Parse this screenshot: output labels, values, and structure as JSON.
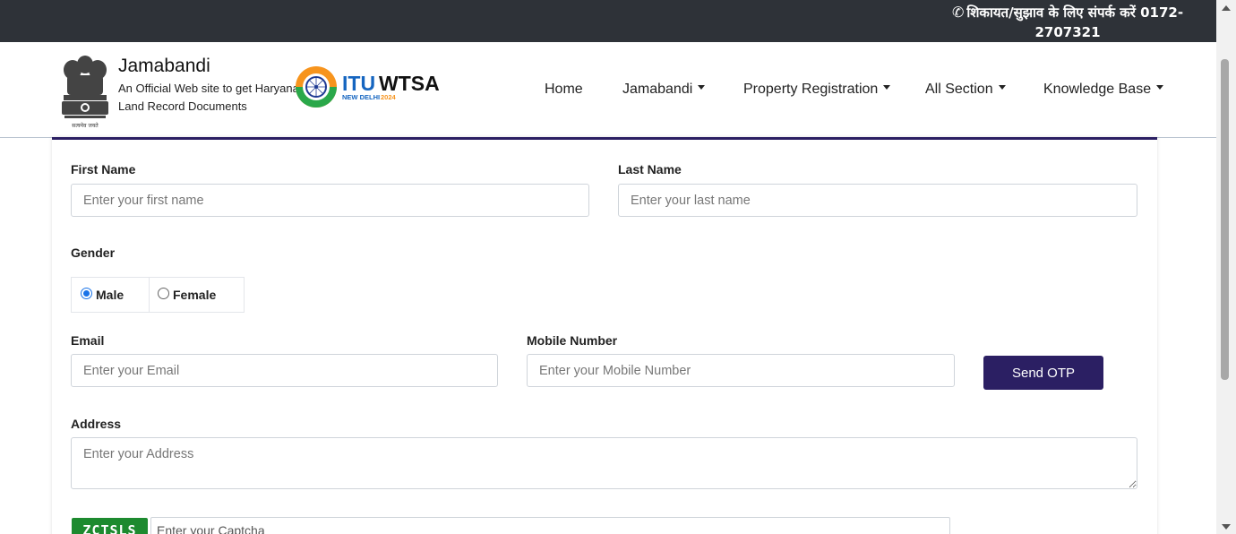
{
  "topbar": {
    "contact_text": "शिकायत/सुझाव के लिए संपर्क करें 0172-2707321",
    "phone_icon": "phone-icon"
  },
  "brand": {
    "title": "Jamabandi",
    "subtitle": "An Official Web site to get Haryana Land Record Documents",
    "emblem_caption": "सत्यमेव जयते",
    "partner_logo_text": "ITUWTSA",
    "partner_logo_subtext": "NEW DELHI 2024"
  },
  "nav": {
    "items": [
      {
        "label": "Home",
        "dropdown": false
      },
      {
        "label": "Jamabandi",
        "dropdown": true
      },
      {
        "label": "Property Registration",
        "dropdown": true
      },
      {
        "label": "All Section",
        "dropdown": true
      },
      {
        "label": "Knowledge Base",
        "dropdown": true
      }
    ]
  },
  "form": {
    "first_name": {
      "label": "First Name",
      "placeholder": "Enter your first name",
      "value": ""
    },
    "last_name": {
      "label": "Last Name",
      "placeholder": "Enter your last name",
      "value": ""
    },
    "gender": {
      "label": "Gender",
      "options": [
        "Male",
        "Female"
      ],
      "selected": "Male"
    },
    "email": {
      "label": "Email",
      "placeholder": "Enter your Email",
      "value": ""
    },
    "mobile": {
      "label": "Mobile Number",
      "placeholder": "Enter your Mobile Number",
      "value": ""
    },
    "send_otp_label": "Send OTP",
    "address": {
      "label": "Address",
      "placeholder": "Enter your Address",
      "value": ""
    },
    "captcha": {
      "code": "ZCTSLS",
      "placeholder": "Enter your Captcha"
    }
  },
  "colors": {
    "topbar_bg": "#2e3238",
    "primary": "#2b1f63",
    "captcha_bg": "#1d8a2f"
  }
}
